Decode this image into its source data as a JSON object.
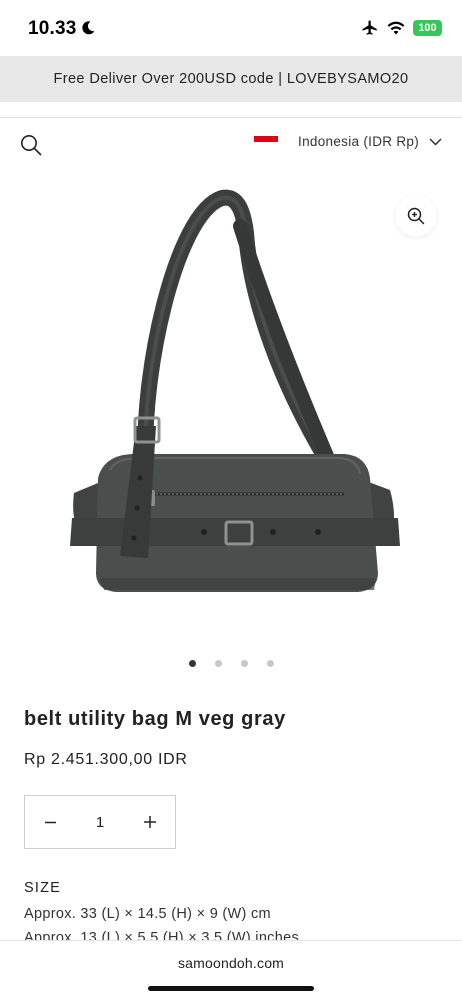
{
  "status_bar": {
    "time": "10.33",
    "battery": "100"
  },
  "announcement": {
    "text": "Free Deliver Over 200USD code | LOVEBYSAMO20"
  },
  "header": {
    "search_icon": "search-icon",
    "country_label": "Indonesia (IDR Rp)",
    "flag_colors": [
      "#e1001a",
      "#ffffff"
    ]
  },
  "gallery": {
    "image_count": 4,
    "active_index": 0,
    "zoom_icon": "zoom-in-icon"
  },
  "product": {
    "title": "belt utility bag M veg gray",
    "price": "Rp 2.451.300,00 IDR"
  },
  "quantity": {
    "value": "1",
    "decrement_icon": "minus-icon",
    "increment_icon": "plus-icon"
  },
  "size": {
    "label": "SIZE",
    "line1": "Approx. 33 (L) × 14.5 (H) × 9 (W) cm",
    "line2": "Approx. 13 (L) × 5.5 (H) × 3.5 (W) inches"
  },
  "browser": {
    "url": "samoondoh.com"
  }
}
